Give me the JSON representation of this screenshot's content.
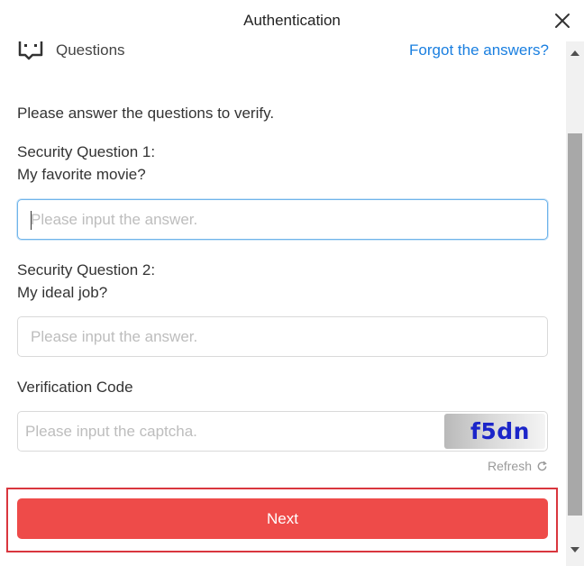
{
  "window": {
    "title": "Authentication",
    "close_icon": "close-icon"
  },
  "section": {
    "icon": "chat-dots-icon",
    "label": "Questions",
    "forgot_link": "Forgot the answers?"
  },
  "form": {
    "intro": "Please answer the questions to verify.",
    "question1": {
      "label": "Security Question 1:",
      "question": "My favorite movie?",
      "value": "",
      "placeholder": "Please input the answer.",
      "focused": true
    },
    "question2": {
      "label": "Security Question 2:",
      "question": "My ideal job?",
      "value": "",
      "placeholder": "Please input the answer."
    },
    "verification": {
      "label": "Verification Code",
      "value": "",
      "placeholder": "Please input the captcha.",
      "captcha_text": "f5dn",
      "refresh_label": "Refresh",
      "refresh_icon": "refresh-icon"
    },
    "next_label": "Next"
  },
  "colors": {
    "accent_link": "#1a7fe0",
    "primary_button": "#ee4b49",
    "highlight_border": "#d9363e",
    "captcha_text": "#1b25c9"
  }
}
